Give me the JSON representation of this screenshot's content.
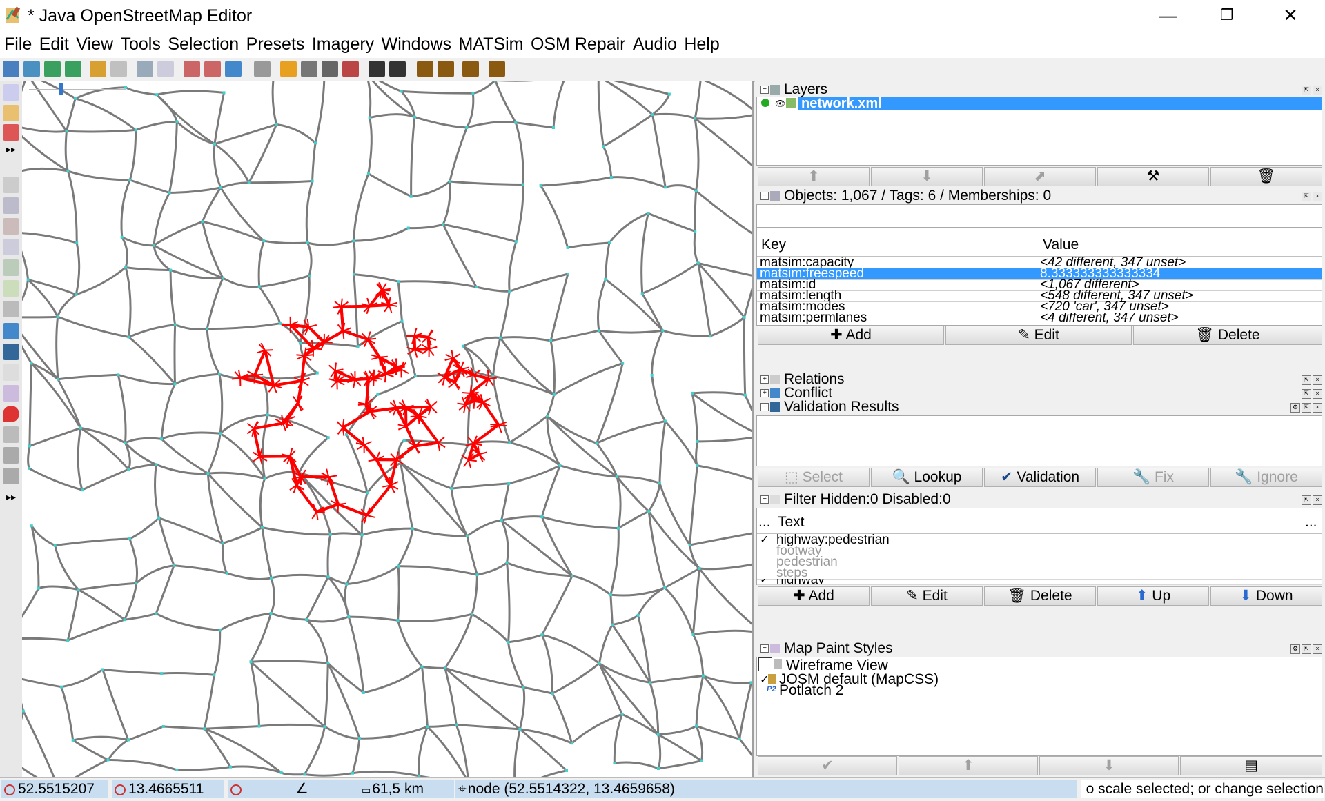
{
  "window": {
    "title": "* Java OpenStreetMap Editor",
    "minimize": "—",
    "restore": "❐",
    "close": "✕"
  },
  "menu": [
    "File",
    "Edit",
    "View",
    "Tools",
    "Selection",
    "Presets",
    "Imagery",
    "Windows",
    "MATSim",
    "OSM Repair",
    "Audio",
    "Help"
  ],
  "layers": {
    "title": "Layers",
    "items": [
      {
        "name": "network.xml",
        "selected": true
      }
    ]
  },
  "objects": {
    "title": "Objects: 1,067 / Tags: 6 / Memberships: 0",
    "col_key": "Key",
    "col_value": "Value",
    "rows": [
      {
        "key": "matsim:capacity",
        "value": "<42 different, 347 unset>"
      },
      {
        "key": "matsim:freespeed",
        "value": "8.333333333333334",
        "selected": true
      },
      {
        "key": "matsim:id",
        "value": "<1,067 different>"
      },
      {
        "key": "matsim:length",
        "value": "<548 different, 347 unset>"
      },
      {
        "key": "matsim:modes",
        "value": "<720 'car', 347 unset>"
      },
      {
        "key": "matsim:permlanes",
        "value": "<4 different, 347 unset>"
      }
    ],
    "add": "Add",
    "edit": "Edit",
    "delete": "Delete"
  },
  "relations": {
    "title": "Relations"
  },
  "conflict": {
    "title": "Conflict"
  },
  "validation": {
    "title": "Validation Results",
    "select": "Select",
    "lookup": "Lookup",
    "validation": "Validation",
    "fix": "Fix",
    "ignore": "Ignore"
  },
  "filter": {
    "title": "Filter Hidden:0 Disabled:0",
    "col_dots": "...",
    "col_text": "Text",
    "col_dots2": "...",
    "rows": [
      {
        "text": "highway:pedestrian",
        "checked": true,
        "enabled": true
      },
      {
        "text": "footway",
        "checked": false,
        "enabled": false
      },
      {
        "text": "pedestrian",
        "checked": false,
        "enabled": false
      },
      {
        "text": "steps",
        "checked": false,
        "enabled": false
      },
      {
        "text": "highway",
        "checked": true,
        "enabled": true
      }
    ],
    "add": "Add",
    "edit": "Edit",
    "delete": "Delete",
    "up": "Up",
    "down": "Down"
  },
  "mappaint": {
    "title": "Map Paint Styles",
    "items": [
      {
        "label": "Wireframe View"
      },
      {
        "label": "JOSM default (MapCSS)"
      },
      {
        "label": "Potlatch 2"
      }
    ]
  },
  "status": {
    "lat": "52.5515207",
    "lon": "13.4665511",
    "heading": "",
    "angle": "",
    "distance": "61,5 km",
    "node": "node (52.5514322, 13.4659658)",
    "help": "o scale selected; or change selection"
  },
  "colors": {
    "road": "#7a7a7a",
    "node": "#40d0d0",
    "selected": "#ff0000",
    "highlight": "#3399ff"
  }
}
